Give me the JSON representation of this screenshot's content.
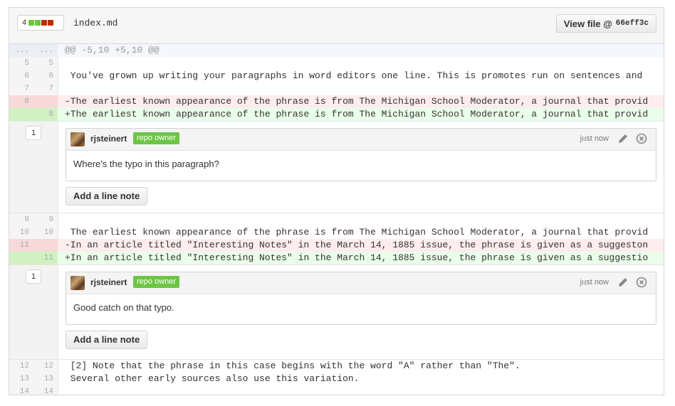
{
  "header": {
    "diffstat_count": "4",
    "file_name": "index.md",
    "view_file_label": "View file @",
    "view_file_sha": "66eff3c"
  },
  "hunk": {
    "old": "...",
    "new": "...",
    "text": "@@ -5,10 +5,10 @@"
  },
  "lines_a": [
    {
      "old": "5",
      "new": "5",
      "text": ""
    },
    {
      "old": "6",
      "new": "6",
      "text": " You've grown up writing your paragraphs in word editors one line. This is promotes run on sentences and"
    },
    {
      "old": "7",
      "new": "7",
      "text": ""
    },
    {
      "old": "8",
      "new": "",
      "text": "-The earliest known appearance of the phrase is from The Michigan School Moderator, a journal that provid"
    },
    {
      "old": "",
      "new": "8",
      "text": "+The earliest known appearance of the phrase is from The Michigan School Moderator, a journal that provid"
    }
  ],
  "comment_a": {
    "count": "1",
    "author": "rjsteinert",
    "badge": "repo owner",
    "time": "just now",
    "body": "Where's the typo in this paragraph?",
    "add_note": "Add a line note"
  },
  "lines_b": [
    {
      "old": "9",
      "new": "9",
      "text": ""
    },
    {
      "old": "10",
      "new": "10",
      "text": " The earliest known appearance of the phrase is from The Michigan School Moderator, a journal that provid"
    },
    {
      "old": "11",
      "new": "",
      "text": "-In an article titled \"Interesting Notes\" in the March 14, 1885 issue, the phrase is given as a suggeston"
    },
    {
      "old": "",
      "new": "11",
      "text": "+In an article titled \"Interesting Notes\" in the March 14, 1885 issue, the phrase is given as a suggestio"
    }
  ],
  "comment_b": {
    "count": "1",
    "author": "rjsteinert",
    "badge": "repo owner",
    "time": "just now",
    "body": "Good catch on that typo.",
    "add_note": "Add a line note"
  },
  "lines_c": [
    {
      "old": "12",
      "new": "12",
      "text": " [2] Note that the phrase in this case begins with the word \"A\" rather than \"The\"."
    },
    {
      "old": "13",
      "new": "13",
      "text": " Several other early sources also use this variation."
    },
    {
      "old": "14",
      "new": "14",
      "text": ""
    }
  ],
  "colors": {
    "add": "#6cc644",
    "del": "#bd2c00",
    "badge": "#6cc644"
  },
  "icons": {
    "edit": "pencil-icon",
    "delete": "close-circle-icon"
  }
}
